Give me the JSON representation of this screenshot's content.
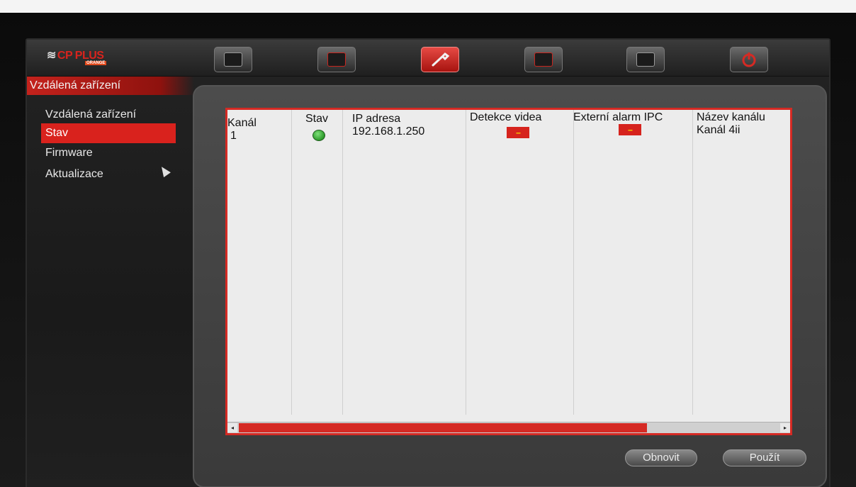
{
  "header": {
    "logo_text": "CP PLUS",
    "logo_sub": "ORANGE",
    "nav_icons": [
      "camera-icon",
      "playback-icon",
      "settings-wrench-icon",
      "info-icon",
      "backup-icon",
      "power-icon"
    ],
    "active_nav": 2
  },
  "section": {
    "title": "Vzdálená zařízení"
  },
  "sidebar": {
    "items": [
      {
        "label": "Vzdálená zařízení"
      },
      {
        "label": "Stav"
      },
      {
        "label": "Firmware"
      },
      {
        "label": "Aktualizace"
      }
    ],
    "active_index": 1
  },
  "table": {
    "headers": {
      "channel": "Kanál",
      "status": "Stav",
      "ip": "IP adresa",
      "video_detect": "Detekce videa",
      "ext_alarm": "Externí alarm IPC",
      "channel_name": "Název kanálu"
    },
    "rows": [
      {
        "channel": "1",
        "status": "online",
        "ip": "192.168.1.250",
        "video_detect": "--",
        "ext_alarm": "--",
        "channel_name": "Kanál 4ii"
      }
    ]
  },
  "buttons": {
    "refresh": "Obnovit",
    "apply": "Použít"
  },
  "colors": {
    "accent_red": "#d52a24",
    "status_green": "#2c9a2a",
    "badge_text": "#f2c400"
  }
}
